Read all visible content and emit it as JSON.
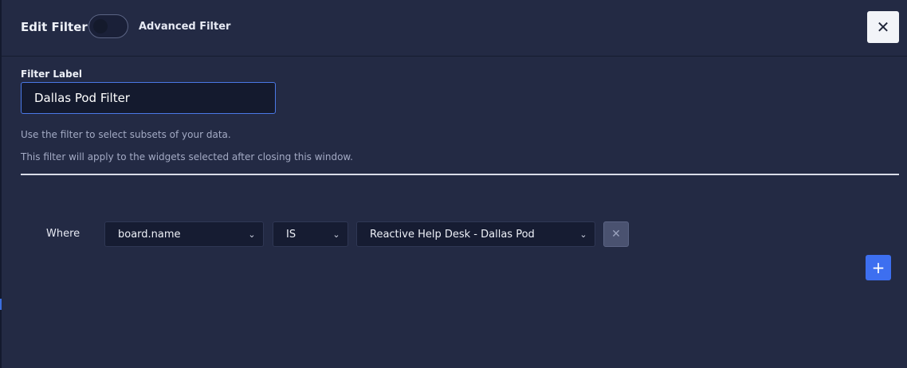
{
  "header": {
    "title": "Edit Filter",
    "advanced_label": "Advanced Filter",
    "advanced_enabled": false,
    "close_icon": "close-icon"
  },
  "form": {
    "label_heading": "Filter Label",
    "label_value": "Dallas Pod Filter",
    "help_1": "Use the filter to select subsets of your data.",
    "help_2": "This filter will apply to the widgets selected after closing this window."
  },
  "condition": {
    "where_label": "Where",
    "field": "board.name",
    "operator": "IS",
    "value": "Reactive Help Desk - Dallas Pod",
    "remove_symbol": "✕",
    "add_symbol": "+"
  },
  "colors": {
    "background": "#232a44",
    "accent": "#3d6ff0",
    "input_border_focus": "#4a78e6"
  }
}
